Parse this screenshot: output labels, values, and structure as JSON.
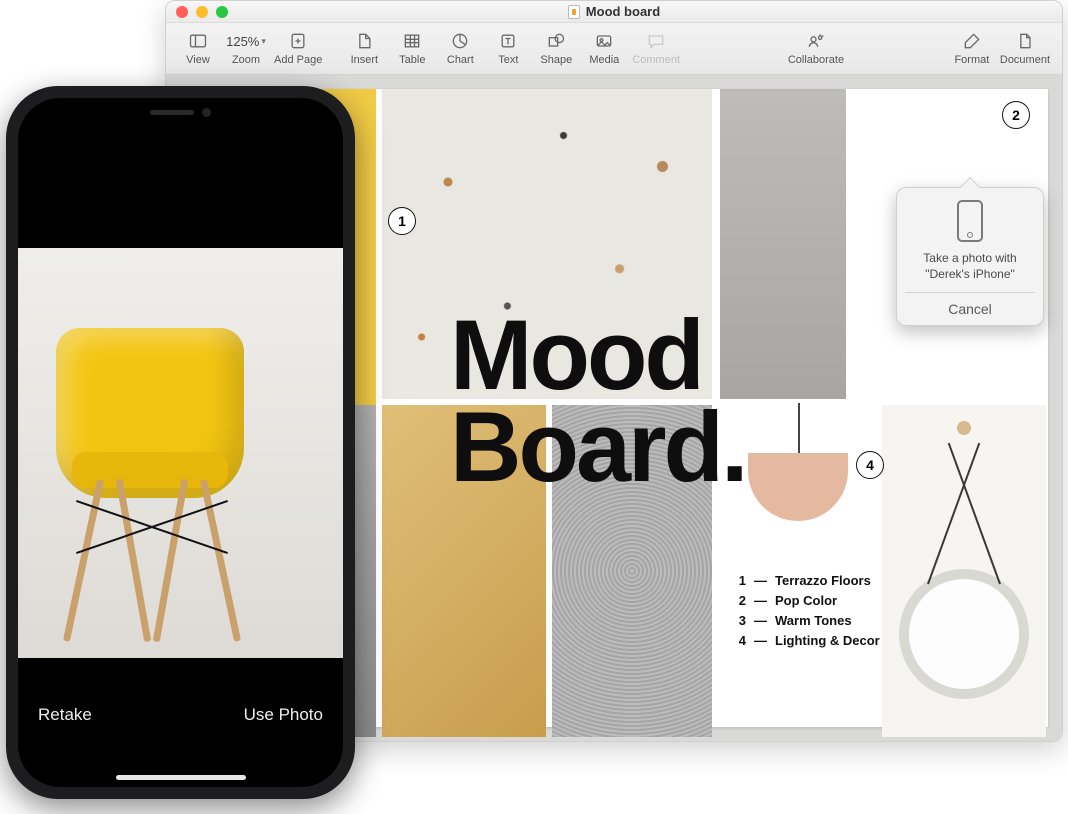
{
  "window": {
    "title": "Mood board"
  },
  "toolbar": {
    "view": "View",
    "zoom_label": "Zoom",
    "zoom_value": "125%",
    "add_page": "Add Page",
    "insert": "Insert",
    "table": "Table",
    "chart": "Chart",
    "text": "Text",
    "shape": "Shape",
    "media": "Media",
    "comment": "Comment",
    "collaborate": "Collaborate",
    "format": "Format",
    "document": "Document"
  },
  "moodboard": {
    "title_line1": "Mood",
    "title_line2": "Board.",
    "legend": [
      {
        "n": "1",
        "t": "Terrazzo Floors"
      },
      {
        "n": "2",
        "t": "Pop Color"
      },
      {
        "n": "3",
        "t": "Warm Tones"
      },
      {
        "n": "4",
        "t": "Lighting & Decor"
      }
    ],
    "callouts": {
      "c1": "1",
      "c2": "2",
      "c4": "4"
    }
  },
  "popover": {
    "message_l1": "Take a photo with",
    "message_l2": "\"Derek's iPhone\"",
    "cancel": "Cancel"
  },
  "iphone": {
    "retake": "Retake",
    "use_photo": "Use Photo"
  }
}
